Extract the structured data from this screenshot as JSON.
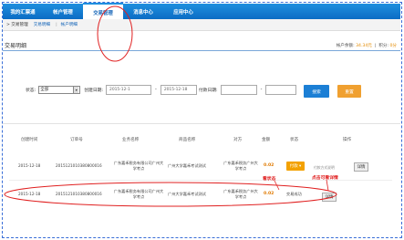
{
  "topnav": {
    "tabs": [
      {
        "label": "我的汇票通"
      },
      {
        "label": "帐户管理"
      },
      {
        "label": "交易管理"
      },
      {
        "label": "消息中心"
      },
      {
        "label": "应用中心"
      }
    ],
    "active_index": 2
  },
  "subnav": {
    "prefix": "> 交易管理",
    "items": [
      "交易明细",
      "帐户明细"
    ]
  },
  "section": {
    "title": "交易明细",
    "balance_label": "帐户余额:",
    "balance_value": "34.34元",
    "points_label": "积分:",
    "points_value": "0分"
  },
  "filter": {
    "status_label": "状态:",
    "status_value": "全部",
    "created_label": "创建日期:",
    "date_from": "2015-12-1",
    "date_to": "2015-12-18",
    "paid_label": "付款日期:",
    "paid_from": "",
    "paid_to": "",
    "search_label": "搜索",
    "reset_label": "重置"
  },
  "table": {
    "headers": [
      "创建时间",
      "订单号",
      "业务名称",
      "商品名称",
      "对方",
      "金额",
      "状态",
      "操作"
    ],
    "rows": [
      {
        "time": "2015-12-18",
        "order": "2015121010380800016",
        "biz_line1": "广东嘉禾税务有限公司广州大",
        "biz_line2": "学考点",
        "product": "广州大学嘉禾考试测试",
        "party_line1": "广东嘉禾税务广州大",
        "party_line2": "学考点",
        "amount": "0.02",
        "status": "",
        "action_pay": "付款 ▾",
        "action_sub": "付款方式说明",
        "action_detail": "详情"
      },
      {
        "time": "2015-12-18",
        "order": "2015121010380800016",
        "biz_line1": "广东嘉禾税务有限公司广州大",
        "biz_line2": "学考点",
        "product": "广州大学嘉禾考试测试",
        "party_line1": "广东嘉禾税务广州大",
        "party_line2": "学考点",
        "amount": "0.02",
        "status": "交易成功",
        "action_detail": "详情"
      }
    ]
  },
  "annotations": {
    "payment_status": "看状态",
    "view_detail": "点击可看详情"
  },
  "colors": {
    "nav_blue": "#0b6cc4",
    "accent_orange": "#f3a100",
    "annotation_red": "#e02020"
  }
}
